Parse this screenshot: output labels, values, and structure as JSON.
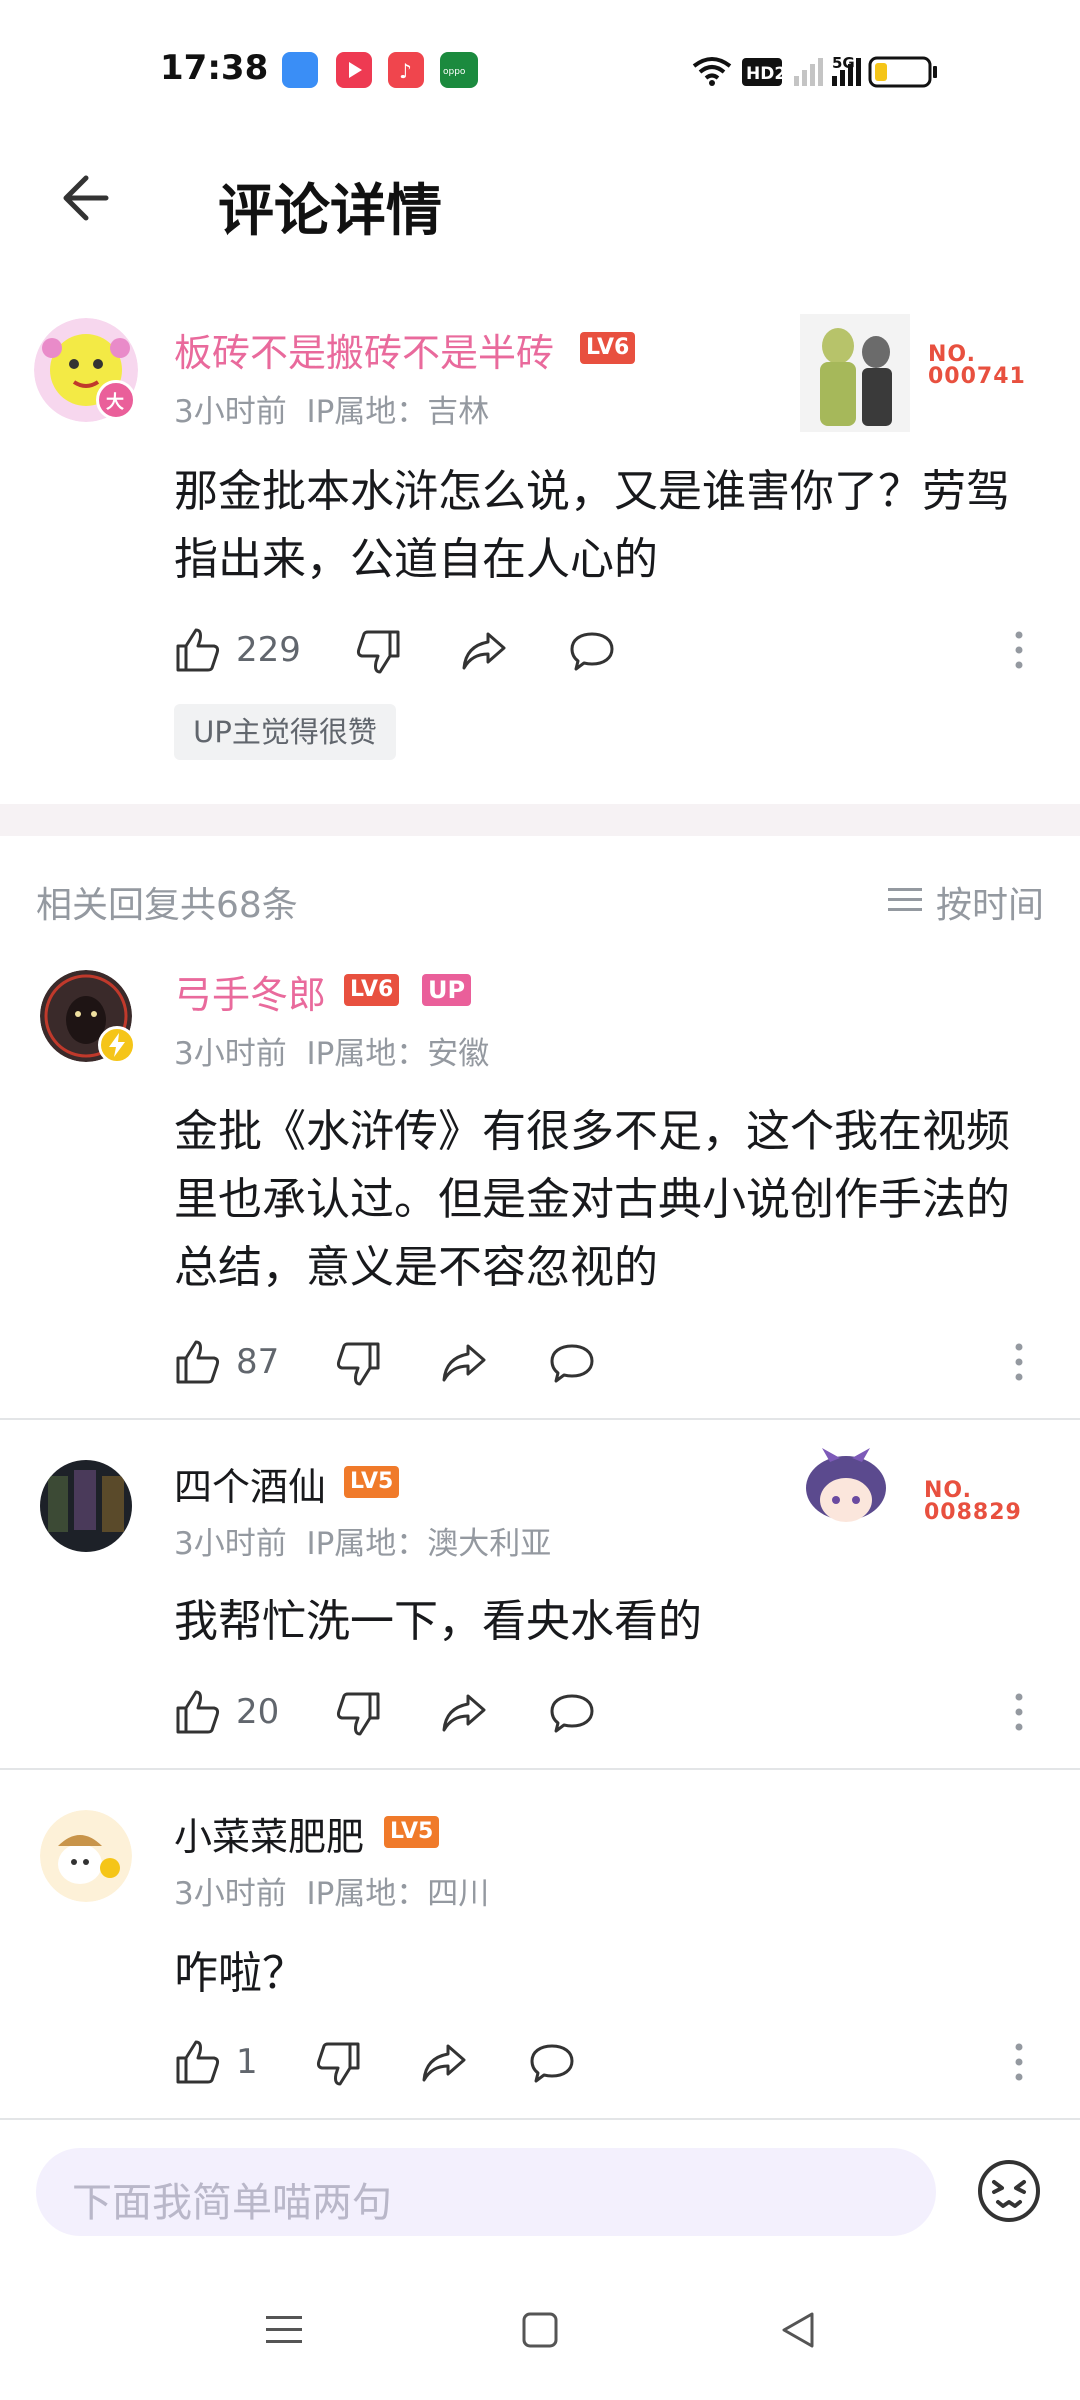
{
  "status_bar": {
    "time": "17:38"
  },
  "header": {
    "title": "评论详情"
  },
  "main_comment": {
    "username": "板砖不是搬砖不是半砖",
    "level": "LV6",
    "time": "3小时前",
    "ip": "IP属地：吉林",
    "content_lines": [
      "那金批本水浒怎么说，又是谁害你了？劳驾",
      "指出来，公道自在人心的"
    ],
    "likes": "229",
    "up_tag": "UP主觉得很赞",
    "badge_no": "NO.",
    "badge_number": "000741"
  },
  "replies": {
    "count_label": "相关回复共68条",
    "sort_label": "按时间",
    "items": [
      {
        "username": "弓手冬郎",
        "level": "LV6",
        "up_badge": "UP",
        "time": "3小时前",
        "ip": "IP属地：安徽",
        "content_lines": [
          "金批《水浒传》有很多不足，这个我在视频",
          "里也承认过。但是金对古典小说创作手法的",
          "总结，意义是不容忽视的"
        ],
        "likes": "87"
      },
      {
        "username": "四个酒仙",
        "level": "LV5",
        "time": "3小时前",
        "ip": "IP属地：澳大利亚",
        "content_lines": [
          "我帮忙洗一下，看央水看的"
        ],
        "likes": "20",
        "badge_no": "NO.",
        "badge_number": "008829"
      },
      {
        "username": "小菜菜肥肥",
        "level": "LV5",
        "time": "3小时前",
        "ip": "IP属地：四川",
        "content_lines": [
          "咋啦？"
        ],
        "likes": "1"
      }
    ]
  },
  "input": {
    "placeholder": "下面我简单喵两句"
  },
  "colors": {
    "pink_name": "#e96a9c",
    "level6": "#e8503f",
    "level5": "#f07a2a",
    "up_badge": "#ea5f9a"
  }
}
